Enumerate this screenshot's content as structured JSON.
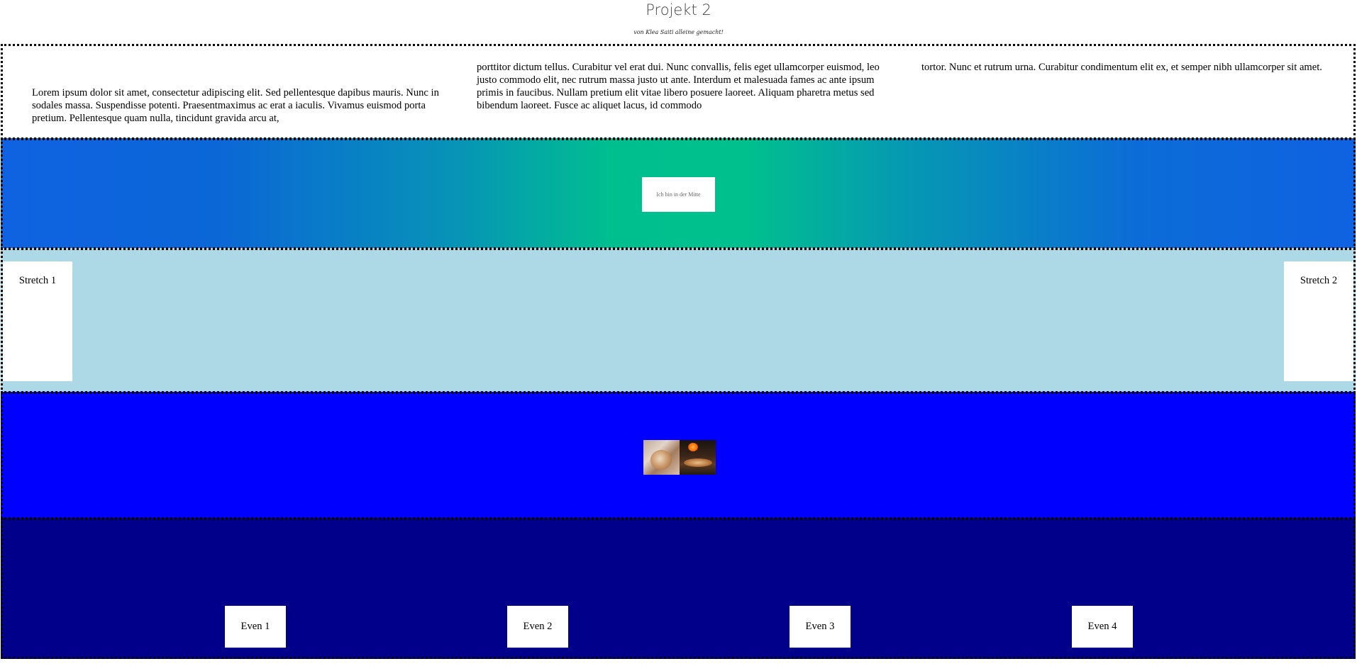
{
  "header": {
    "title": "Projekt 2",
    "subtitle": "von Klea Saiti alleine gemacht!"
  },
  "text_section": {
    "column_1": "Lorem ipsum dolor sit amet, consectetur adipiscing elit. Sed pellentesque dapibus mauris. Nunc in sodales massa. Suspendisse potenti. Praesentmaximus ac erat a iaculis. Vivamus euismod porta pretium. Pellentesque quam nulla, tincidunt gravida arcu at,",
    "column_2": "porttitor dictum tellus. Curabitur vel erat dui. Nunc convallis, felis eget ullamcorper euismod, leo justo commodo elit, nec rutrum massa justo ut ante. Interdum et malesuada fames ac ante ipsum primis in faucibus. Nullam pretium elit vitae libero posuere laoreet. Aliquam pharetra metus sed bibendum laoreet. Fusce ac aliquet lacus, id commodo",
    "column_3": "tortor. Nunc et rutrum urna. Curabitur condimentum elit ex, et semper nibh ullamcorper sit amet."
  },
  "gradient_section": {
    "center_label": "Ich bin in der Mitte"
  },
  "stretch_section": {
    "items": [
      "Stretch 1",
      "Stretch 2"
    ]
  },
  "images_section": {
    "images": [
      "pizza-image",
      "pizza-oven-image"
    ]
  },
  "even_section": {
    "items": [
      "Even 1",
      "Even 2",
      "Even 3",
      "Even 4"
    ]
  },
  "colors": {
    "gradient_edge": "#0f62e1",
    "gradient_center": "#00c08d",
    "stretch_bg": "#add8e6",
    "images_bg": "#0000ff",
    "even_bg": "#00008b"
  }
}
